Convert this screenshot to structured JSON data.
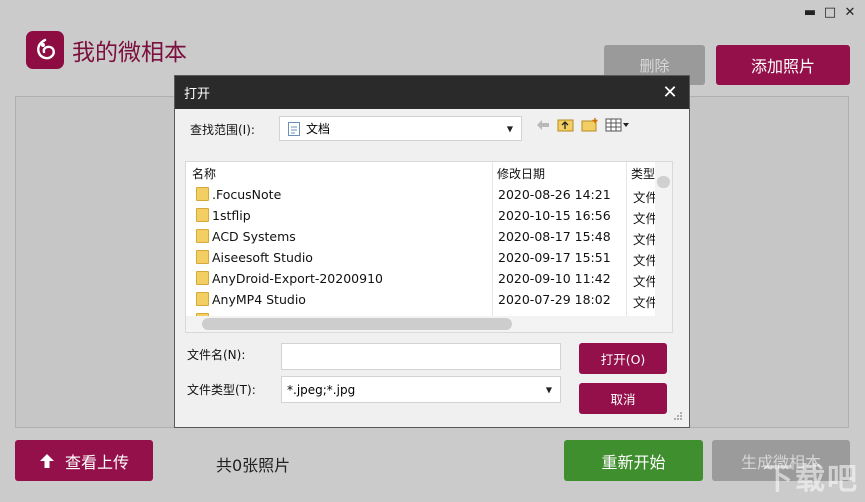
{
  "window": {
    "min": "▬",
    "max": "□",
    "close": "✕"
  },
  "app": {
    "title": "我的微相本",
    "delete_label": "删除",
    "add_label": "添加照片",
    "upload_label": "查看上传",
    "count_label": "共0张照片",
    "restart_label": "重新开始",
    "generate_label": "生成微相本",
    "watermark": "下载吧"
  },
  "dialog": {
    "title": "打开",
    "close": "✕",
    "lookin_label": "查找范围(I):",
    "lookin_value": "文档",
    "columns": {
      "name": "名称",
      "date": "修改日期",
      "type": "类型"
    },
    "rows": [
      {
        "name": ".FocusNote",
        "date": "2020-08-26 14:21",
        "type": "文件"
      },
      {
        "name": "1stflip",
        "date": "2020-10-15 16:56",
        "type": "文件"
      },
      {
        "name": "ACD Systems",
        "date": "2020-08-17 15:48",
        "type": "文件"
      },
      {
        "name": "Aiseesoft Studio",
        "date": "2020-09-17 15:51",
        "type": "文件"
      },
      {
        "name": "AnyDroid-Export-20200910",
        "date": "2020-09-10 11:42",
        "type": "文件"
      },
      {
        "name": "AnyMP4 Studio",
        "date": "2020-07-29 18:02",
        "type": "文件"
      }
    ],
    "filename_label": "文件名(N):",
    "filename_value": "",
    "filetype_label": "文件类型(T):",
    "filetype_value": "*.jpeg;*.jpg",
    "open_label": "打开(O)",
    "cancel_label": "取消"
  },
  "colors": {
    "accent": "#94104a",
    "green": "#3f8f2e",
    "titlebar": "#2a2a2a"
  }
}
